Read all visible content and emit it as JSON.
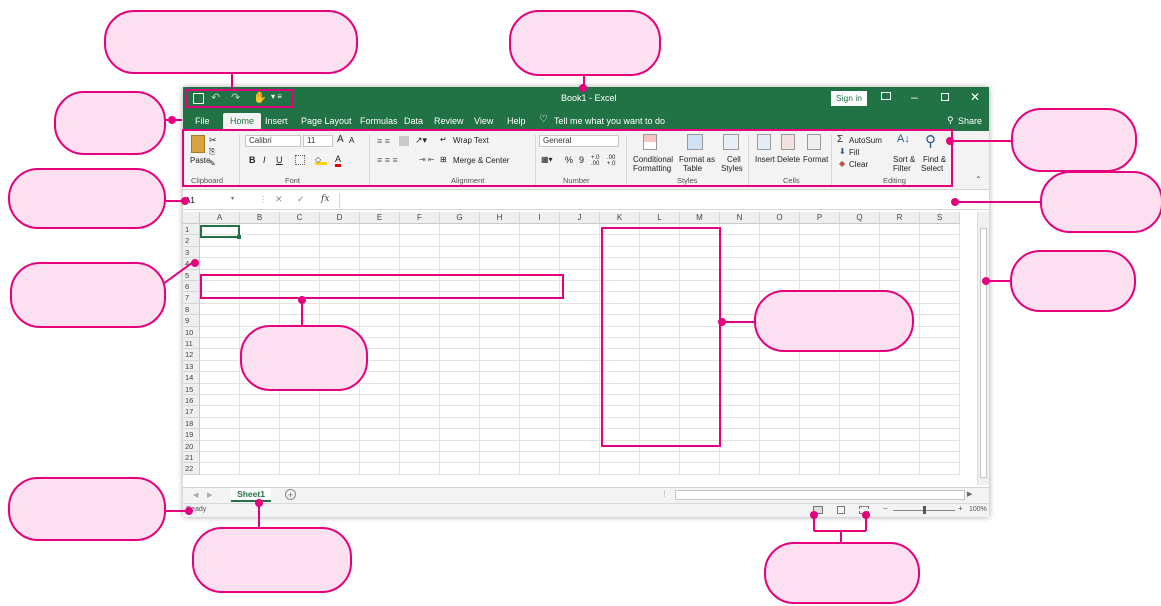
{
  "window": {
    "title": "Book1  -  Excel",
    "sign_in": "Sign in",
    "share": "Share",
    "tell_me": "Tell me what you want to do"
  },
  "tabs": [
    "File",
    "Home",
    "Insert",
    "Page Layout",
    "Formulas",
    "Data",
    "Review",
    "View",
    "Help"
  ],
  "ribbon": {
    "clipboard": {
      "paste": "Paste",
      "group": "Clipboard"
    },
    "font": {
      "name": "Calibri",
      "size": "11",
      "bold": "B",
      "italic": "I",
      "underline": "U",
      "grow": "A",
      "shrink": "A",
      "color": "A",
      "group": "Font"
    },
    "alignment": {
      "wrap": "Wrap Text",
      "merge": "Merge & Center",
      "group": "Alignment"
    },
    "number": {
      "format": "General",
      "percent": "%",
      "comma": "9",
      "dec_inc": "+.0 .00",
      "dec_dec": ".00 +.0",
      "group": "Number"
    },
    "styles": {
      "conditional1": "Conditional",
      "conditional2": "Formatting",
      "format_as1": "Format as",
      "format_as2": "Table",
      "cell1": "Cell",
      "cell2": "Styles",
      "group": "Styles"
    },
    "cells": {
      "insert": "Insert",
      "delete": "Delete",
      "format": "Format",
      "group": "Cells"
    },
    "editing": {
      "autosum": "AutoSum",
      "fill": "Fill",
      "clear": "Clear",
      "sort1": "Sort &",
      "sort2": "Filter",
      "find1": "Find &",
      "find2": "Select",
      "group": "Editing"
    }
  },
  "formula_bar": {
    "name_box": "A1",
    "fx": "fx",
    "cancel": "✕",
    "enter": "✓"
  },
  "grid": {
    "columns": [
      "A",
      "B",
      "C",
      "D",
      "E",
      "F",
      "G",
      "H",
      "I",
      "J",
      "K",
      "L",
      "M",
      "N",
      "O",
      "P",
      "Q",
      "R",
      "S"
    ],
    "rows": [
      "1",
      "2",
      "3",
      "4",
      "5",
      "6",
      "7",
      "8",
      "9",
      "10",
      "11",
      "12",
      "13",
      "14",
      "15",
      "16",
      "17",
      "18",
      "19",
      "20",
      "21",
      "22"
    ]
  },
  "sheets": {
    "active": "Sheet1",
    "add": "+"
  },
  "status": {
    "ready": "Ready",
    "zoom": "100%",
    "minus": "−",
    "plus": "+"
  },
  "colors": {
    "accent": "#217346",
    "callout_border": "#e6007e",
    "callout_fill": "#fde0ef"
  }
}
